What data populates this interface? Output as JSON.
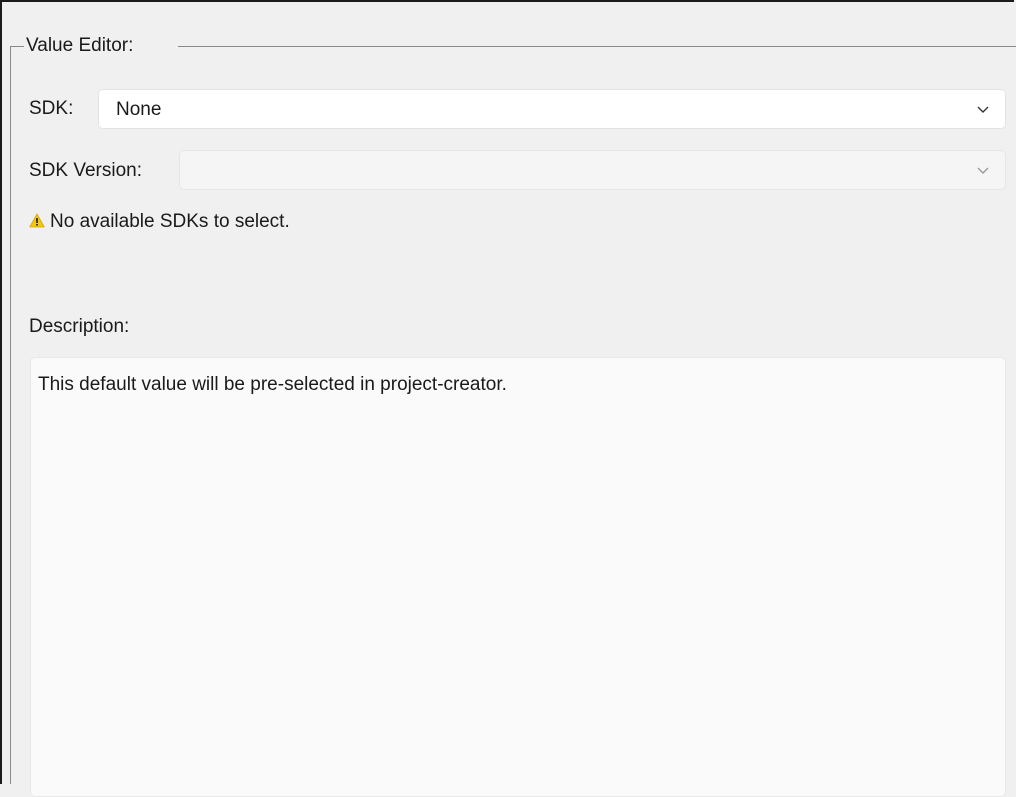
{
  "value_editor": {
    "title": "Value Editor:",
    "sdk": {
      "label": "SDK:",
      "selected": "None",
      "icon": "chevron-down-icon"
    },
    "sdk_version": {
      "label": "SDK Version:",
      "selected": "",
      "enabled": false,
      "icon": "chevron-down-icon"
    },
    "warning": {
      "icon": "warning-icon",
      "icon_color": "#f2c811",
      "text": "No available SDKs to select."
    },
    "description": {
      "label": "Description:",
      "text": "This default value will be pre-selected in project-creator."
    }
  }
}
